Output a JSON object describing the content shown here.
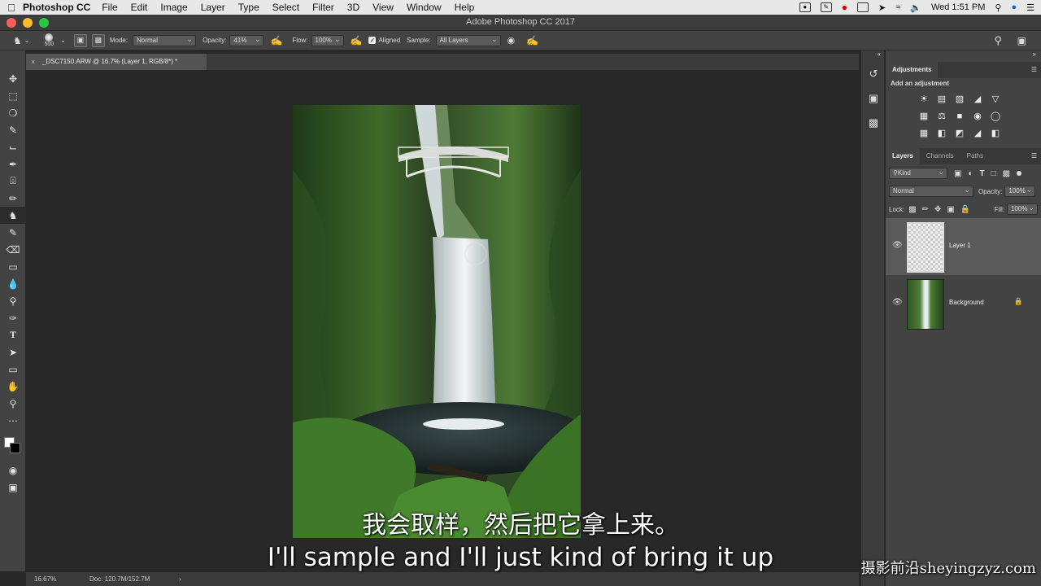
{
  "menubar": {
    "app": "Photoshop CC",
    "items": [
      "File",
      "Edit",
      "Image",
      "Layer",
      "Type",
      "Select",
      "Filter",
      "3D",
      "View",
      "Window",
      "Help"
    ],
    "clock": "Wed 1:51 PM"
  },
  "window": {
    "title": "Adobe Photoshop CC 2017"
  },
  "options": {
    "brush_size": "500",
    "mode_label": "Mode:",
    "mode_value": "Normal",
    "opacity_label": "Opacity:",
    "opacity_value": "41%",
    "flow_label": "Flow:",
    "flow_value": "100%",
    "aligned_label": "Aligned",
    "sample_label": "Sample:",
    "sample_value": "All Layers"
  },
  "document": {
    "tab_title": "_DSC7150.ARW @ 16.7% (Layer 1, RGB/8*) *"
  },
  "status": {
    "zoom": "16.67%",
    "doc": "Doc: 120.7M/152.7M"
  },
  "adjustments": {
    "title": "Adjustments",
    "subtitle": "Add an adjustment"
  },
  "layers_panel": {
    "tabs": [
      "Layers",
      "Channels",
      "Paths"
    ],
    "filter": "Kind",
    "blend_mode": "Normal",
    "opacity_label": "Opacity:",
    "opacity_value": "100%",
    "lock_label": "Lock:",
    "fill_label": "Fill:",
    "fill_value": "100%",
    "layers": [
      {
        "name": "Layer 1"
      },
      {
        "name": "Background"
      }
    ]
  },
  "subtitles": {
    "chinese": "我会取样，然后把它拿上来。",
    "english": "I'll sample and I'll just kind of bring it up"
  },
  "watermark": "摄影前沿sheyingzyz.com",
  "colors": {
    "app_bg": "#282828",
    "panel": "#434343",
    "accent": "#2b2b2b"
  }
}
